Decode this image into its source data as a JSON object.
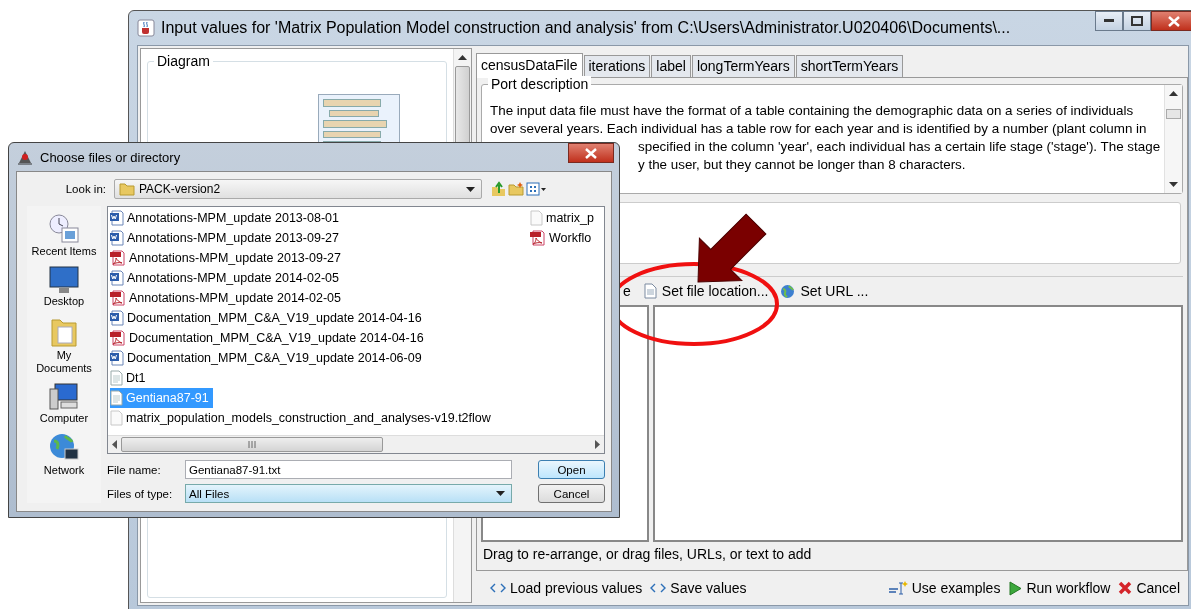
{
  "window": {
    "title": "Input values for 'Matrix Population Model construction and analysis' from C:\\Users\\Administrator.U020406\\Documents\\..."
  },
  "diagram": {
    "title": "Diagram"
  },
  "tabs": [
    {
      "label": "censusDataFile",
      "selected": true
    },
    {
      "label": "iterations",
      "selected": false
    },
    {
      "label": "label",
      "selected": false
    },
    {
      "label": "longTermYears",
      "selected": false
    },
    {
      "label": "shortTermYears",
      "selected": false
    }
  ],
  "port_description": {
    "title": "Port description",
    "lines": [
      {
        "text": "The input data file must have the format of a table containing the demographic data on a series of individuals",
        "covered": false
      },
      {
        "text": "over several years. Each individual has a table row for each year and is identified by a number (plant column in",
        "covered": false
      },
      {
        "text": "specified in the column 'year', each individual has a certain life stage ('stage'). The stage",
        "covered": true
      },
      {
        "text": "y the user, but they cannot be longer than 8 characters.",
        "covered": true
      }
    ]
  },
  "value_toolbar": [
    {
      "label": "e"
    },
    {
      "label": "Set file location..."
    },
    {
      "label": "Set URL ..."
    }
  ],
  "hint": "Drag to re-arrange, or drag files, URLs, or text to add",
  "footer_left": [
    {
      "label": "Load previous values"
    },
    {
      "label": "Save values"
    }
  ],
  "footer_right": [
    {
      "label": "Use examples"
    },
    {
      "label": "Run workflow"
    },
    {
      "label": "Cancel"
    }
  ],
  "dialog": {
    "title": "Choose files or directory",
    "look_in_label": "Look in:",
    "look_in": "PACK-version2",
    "places": [
      {
        "label": "Recent Items"
      },
      {
        "label": "Desktop"
      },
      {
        "label": "My Documents"
      },
      {
        "label": "Computer"
      },
      {
        "label": "Network"
      }
    ],
    "files": [
      {
        "name": "Annotations-MPM_update 2013-08-01",
        "kind": "word",
        "selected": false
      },
      {
        "name": "Annotations-MPM_update 2013-09-27",
        "kind": "word",
        "selected": false
      },
      {
        "name": "Annotations-MPM_update 2013-09-27",
        "kind": "pdf",
        "selected": false
      },
      {
        "name": "Annotations-MPM_update 2014-02-05",
        "kind": "word",
        "selected": false
      },
      {
        "name": "Annotations-MPM_update 2014-02-05",
        "kind": "pdf",
        "selected": false
      },
      {
        "name": "Documentation_MPM_C&A_V19_update 2014-04-16",
        "kind": "word",
        "selected": false
      },
      {
        "name": "Documentation_MPM_C&A_V19_update 2014-04-16",
        "kind": "pdf",
        "selected": false
      },
      {
        "name": "Documentation_MPM_C&A_V19_update 2014-06-09",
        "kind": "word",
        "selected": false
      },
      {
        "name": "Dt1",
        "kind": "text",
        "selected": false
      },
      {
        "name": "Gentiana87-91",
        "kind": "text",
        "selected": true
      },
      {
        "name": "matrix_population_models_construction_and_analyses-v19.t2flow",
        "kind": "blank",
        "selected": false
      }
    ],
    "files_column_2": [
      {
        "name": "matrix_p",
        "kind": "blank",
        "selected": false
      },
      {
        "name": "Workflo",
        "kind": "pdf",
        "selected": false
      }
    ],
    "file_name_label": "File name:",
    "file_name": "Gentiana87-91.txt",
    "file_type_label": "Files of type:",
    "file_type": "All Files",
    "buttons": [
      {
        "label": "Open",
        "kind": "default"
      },
      {
        "label": "Cancel",
        "kind": "normal"
      }
    ]
  }
}
